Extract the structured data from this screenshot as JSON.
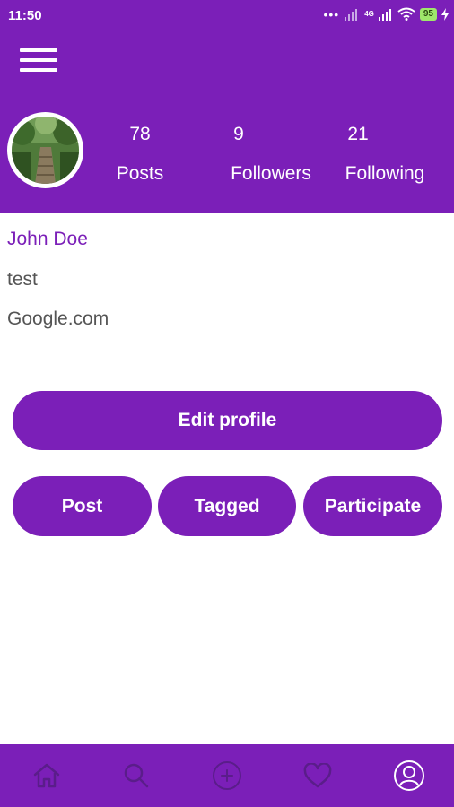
{
  "status_bar": {
    "time": "11:50",
    "network": "4G",
    "battery": "95"
  },
  "stats": [
    {
      "value": "78",
      "label": "Posts"
    },
    {
      "value": "9",
      "label": "Followers"
    },
    {
      "value": "21",
      "label": "Following"
    }
  ],
  "profile": {
    "name": "John Doe",
    "bio": "test",
    "website": "Google.com"
  },
  "buttons": {
    "edit_profile": "Edit profile",
    "post": "Post",
    "tagged": "Tagged",
    "participate": "Participate"
  },
  "nav": {
    "items": [
      "home-icon",
      "search-icon",
      "add-icon",
      "heart-icon",
      "profile-icon"
    ],
    "active": "profile-icon"
  },
  "colors": {
    "primary": "#7b1fb8",
    "nav_inactive": "#5a1d8a",
    "nav_active": "#ffffff",
    "battery": "#9ee86b"
  }
}
